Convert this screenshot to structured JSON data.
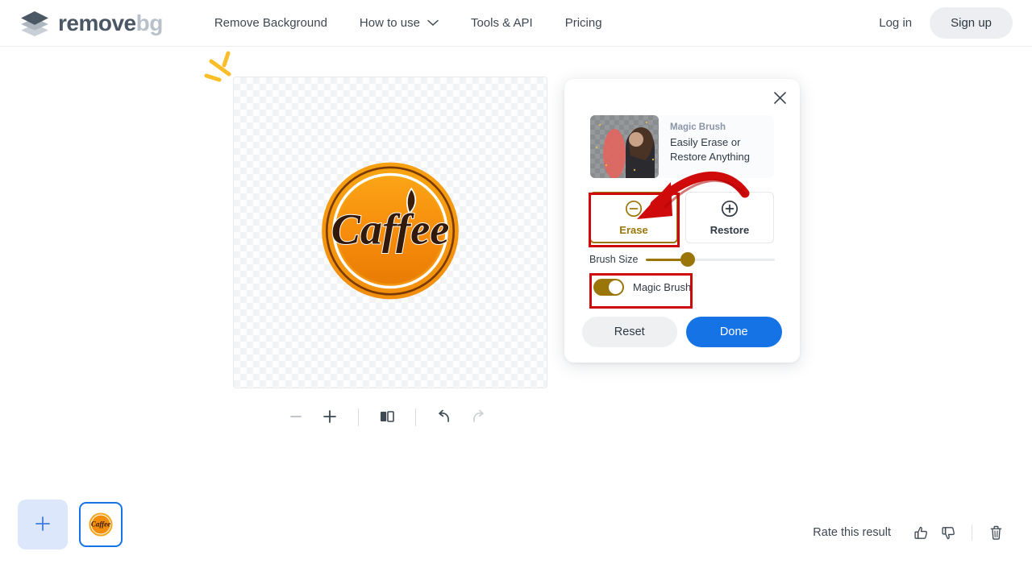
{
  "header": {
    "brand": {
      "primary": "remove",
      "secondary": "bg",
      "logo_icon": "layers-diamond-icon"
    },
    "nav": [
      {
        "label": "Remove Background",
        "icon": "",
        "name": "nav-remove-background"
      },
      {
        "label": "How to use",
        "icon": "chevron-down-icon",
        "name": "nav-how-to-use"
      },
      {
        "label": "Tools & API",
        "icon": "",
        "name": "nav-tools-api"
      },
      {
        "label": "Pricing",
        "icon": "",
        "name": "nav-pricing"
      }
    ],
    "login_label": "Log in",
    "signup_label": "Sign up"
  },
  "editor": {
    "image_title": "Caffee",
    "toolbar": [
      {
        "name": "zoom-out-button",
        "icon": "minus-icon",
        "enabled": false
      },
      {
        "name": "zoom-in-button",
        "icon": "plus-icon",
        "enabled": true
      },
      {
        "name": "compare-button",
        "icon": "compare-split-icon",
        "enabled": true
      },
      {
        "name": "undo-button",
        "icon": "undo-arrow-icon",
        "enabled": true
      },
      {
        "name": "redo-button",
        "icon": "redo-arrow-icon",
        "enabled": false
      }
    ]
  },
  "panel": {
    "close_icon": "close-icon",
    "promo": {
      "title": "Magic Brush",
      "subtitle": "Easily Erase or Restore Anything",
      "thumbnail_alt": "woman-with-red-brush-stroke"
    },
    "modes": [
      {
        "label": "Erase",
        "icon": "circle-minus-icon",
        "selected": true
      },
      {
        "label": "Restore",
        "icon": "circle-plus-icon",
        "selected": false
      }
    ],
    "brush_size_label": "Brush Size",
    "brush_size_value": 32,
    "magic_brush_label": "Magic Brush",
    "magic_brush_on": true,
    "reset_label": "Reset",
    "done_label": "Done"
  },
  "footer": {
    "add_label": "+",
    "rate_text": "Rate this result",
    "thumbs_up_icon": "thumbs-up-icon",
    "thumbs_down_icon": "thumbs-down-icon",
    "delete_icon": "trash-icon"
  },
  "colors": {
    "accent_blue": "#1673e6",
    "gold": "#9a7508",
    "annotation_red": "#cf0a0a",
    "brand_dark": "#4a5765",
    "brand_light": "#b8c0c9"
  }
}
